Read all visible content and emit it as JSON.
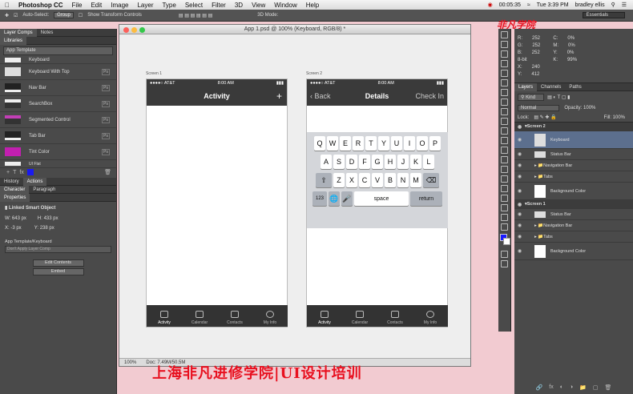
{
  "menubar": {
    "app": "Photoshop CC",
    "items": [
      "File",
      "Edit",
      "Image",
      "Layer",
      "Type",
      "Select",
      "Filter",
      "3D",
      "View",
      "Window",
      "Help"
    ],
    "timer": "00:05:35",
    "day_time": "Tue 3:39 PM",
    "user": "bradley ellis"
  },
  "options": {
    "auto_select": "Auto-Select:",
    "group": "Group",
    "show_transform": "Show Transform Controls",
    "mode3d": "3D Mode:",
    "workspace": "Essentials"
  },
  "left": {
    "tabs1": [
      "Layer Comps",
      "Notes"
    ],
    "libraries": "Libraries",
    "template": "App Template",
    "lib_items": [
      "Keyboard",
      "Keyboard With Top",
      "Nav Bar",
      "SearchBox",
      "Segmented Control",
      "Tab Bar",
      "Tint Color",
      "UI Flat"
    ],
    "tabs2": [
      "History",
      "Actions"
    ],
    "tabs3": [
      "Character",
      "Paragraph"
    ],
    "props": "Properties",
    "smart": "Linked Smart Object",
    "w": "W: 643 px",
    "h": "H: 433 px",
    "x": "X: -3 px",
    "y": "Y: 238 px",
    "comp_label": "App Template/Keyboard",
    "comp_value": "Don't Apply Layer Comp",
    "edit": "Edit Contents",
    "embed": "Embed"
  },
  "canvas": {
    "title": "App 1.psd @ 100% (Keyboard, RGB/8) *",
    "screen1": "Screen 1",
    "screen2": "Screen 2",
    "carrier": "●●●●○ AT&T",
    "time": "8:00 AM",
    "nav1": "Activity",
    "plus": "+",
    "nav2": "Details",
    "back": "‹ Back",
    "checkin": "Check In",
    "row1": [
      "Q",
      "W",
      "E",
      "R",
      "T",
      "Y",
      "U",
      "I",
      "O",
      "P"
    ],
    "row2": [
      "A",
      "S",
      "D",
      "F",
      "G",
      "H",
      "J",
      "K",
      "L"
    ],
    "row3": [
      "Z",
      "X",
      "C",
      "V",
      "B",
      "N",
      "M"
    ],
    "k123": "123",
    "space": "space",
    "ret": "return",
    "tabs": [
      "Activity",
      "Calendar",
      "Contacts",
      "My Info"
    ],
    "zoom": "100%",
    "docsize": "Doc: 7.49M/50.5M"
  },
  "right": {
    "info": [
      "R:",
      "G:",
      "B:",
      "8-bit",
      "X:",
      "Y:"
    ],
    "info_vals": [
      "252",
      "252",
      "252",
      "",
      "240",
      "412"
    ],
    "cmyk": [
      "C:",
      "M:",
      "Y:",
      "K:"
    ],
    "cmyk_vals": [
      "0%",
      "0%",
      "0%",
      "99%"
    ],
    "tabs": [
      "Layers",
      "Channels",
      "Paths"
    ],
    "kind": "Kind",
    "blend": "Normal",
    "opacity": "Opacity: 100%",
    "lock": "Lock:",
    "fill": "Fill: 100%",
    "layers": [
      {
        "name": "Screen 2",
        "type": "group"
      },
      {
        "name": "Keyboard",
        "type": "sel"
      },
      {
        "name": "Status Bar",
        "type": "layer"
      },
      {
        "name": "Navigation Bar",
        "type": "folder"
      },
      {
        "name": "Tabs",
        "type": "folder"
      },
      {
        "name": "Background Color",
        "type": "layer"
      },
      {
        "name": "Screen 1",
        "type": "group"
      },
      {
        "name": "Status Bar",
        "type": "layer"
      },
      {
        "name": "Navigation Bar",
        "type": "folder"
      },
      {
        "name": "Tabs",
        "type": "folder"
      },
      {
        "name": "Background Color",
        "type": "layer"
      }
    ]
  },
  "watermark": "上海非凡进修学院|UI设计培训",
  "logo": "非凡学院"
}
